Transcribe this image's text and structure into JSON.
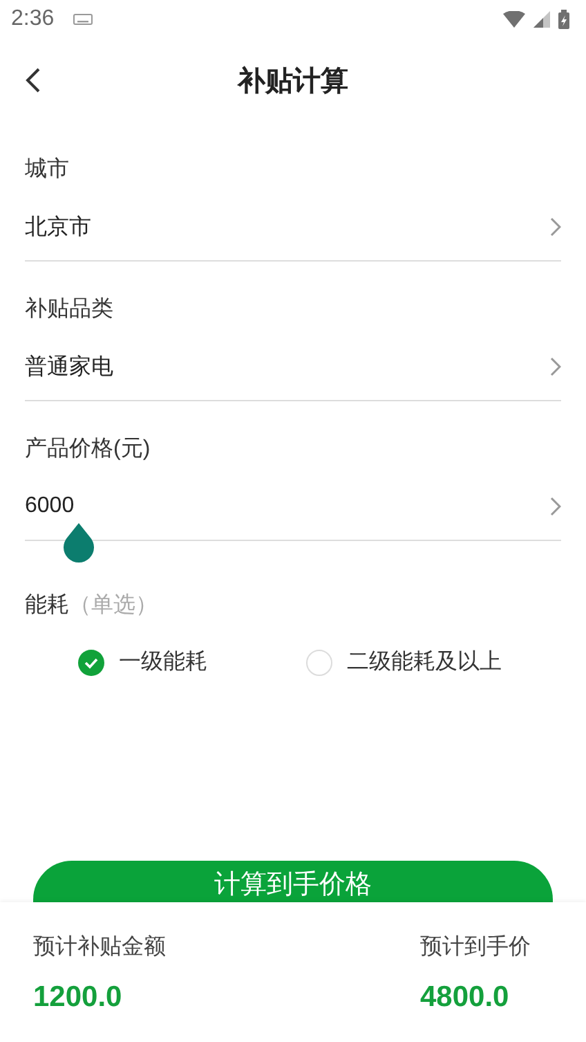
{
  "status_bar": {
    "time": "2:36"
  },
  "header": {
    "title": "补贴计算"
  },
  "fields": [
    {
      "kind": "select",
      "label": "城市",
      "value": "北京市"
    },
    {
      "kind": "select",
      "label": "补贴品类",
      "value": "普通家电"
    },
    {
      "kind": "slider",
      "label": "产品价格(元)",
      "value": "6000",
      "level": 0.1
    }
  ],
  "energy": {
    "label": "能耗",
    "hint": "（单选）",
    "options": [
      {
        "label": "一级能耗",
        "selected": true
      },
      {
        "label": "二级能耗及以上",
        "selected": false
      }
    ]
  },
  "calculate_button": "计算到手价格",
  "results": [
    {
      "label": "预计补贴金额",
      "value": "1200.0"
    },
    {
      "label": "预计到手价",
      "value": "4800.0"
    }
  ]
}
